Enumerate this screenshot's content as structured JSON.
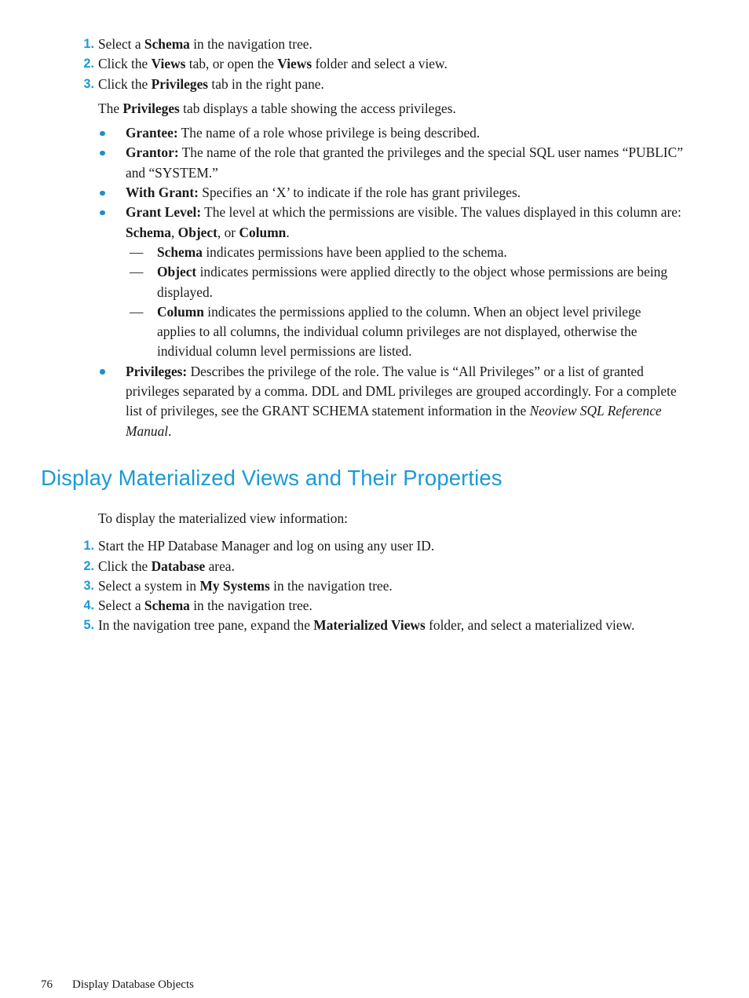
{
  "document": {
    "colors": {
      "heading": "#1b9ad6",
      "list_number": "#1b9ad6",
      "bullet": "#1b8fc9",
      "body_text": "#1a1a1a",
      "page_background": "#ffffff"
    }
  },
  "privileges_procedure": {
    "steps": [
      {
        "number": "1.",
        "html": "Select a <b>Schema</b> in the navigation tree."
      },
      {
        "number": "2.",
        "html": "Click the <b>Views</b> tab, or open the <b>Views</b> folder and select a view."
      },
      {
        "number": "3.",
        "html": "Click the <b>Privileges</b> tab in the right pane."
      }
    ],
    "intro_paragraph_html": "The <b>Privileges</b> tab displays a table showing the access privileges."
  },
  "privileges_columns": {
    "items": [
      {
        "term": "Grantee:",
        "html": "<b>Grantee:</b> The name of a role whose privilege is being described."
      },
      {
        "term": "Grantor:",
        "html": "<b>Grantor:</b> The name of the role that granted the privileges and the special SQL user names “PUBLIC” and “SYSTEM.”"
      },
      {
        "term": "With Grant:",
        "html": "<b>With Grant:</b> Specifies an ‘X’ to indicate if the role has grant privileges."
      },
      {
        "term": "Grant Level:",
        "html": "<b>Grant Level:</b> The level at which the permissions are visible. The values displayed in this column are: <b>Schema</b>, <b>Object</b>, or <b>Column</b>."
      },
      {
        "term": "Privileges:",
        "html": "<b>Privileges:</b> Describes the privilege of the role. The value is “All Privileges” or a list of granted privileges separated by a comma. DDL and DML privileges are grouped accordingly. For a complete list of privileges, see the GRANT SCHEMA statement information in the <i>Neoview SQL Reference Manual</i>."
      }
    ],
    "grant_level_sublist": [
      {
        "dash": "—",
        "html": "<b>Schema</b> indicates permissions have been applied to the schema."
      },
      {
        "dash": "—",
        "html": "<b>Object</b> indicates permissions were applied directly to the object whose permissions are being displayed."
      },
      {
        "dash": "—",
        "html": "<b>Column</b> indicates the permissions applied to the column. When an object level privilege applies to all columns, the individual column privileges are not displayed, otherwise the individual column level permissions are listed."
      }
    ]
  },
  "materialized_views_section": {
    "heading": "Display Materialized Views and Their Properties",
    "intro_paragraph_html": "To display the materialized view information:",
    "steps": [
      {
        "number": "1.",
        "html": "Start the HP Database Manager and log on using any user ID."
      },
      {
        "number": "2.",
        "html": "Click the <b>Database</b> area."
      },
      {
        "number": "3.",
        "html": "Select a system in <b>My Systems</b> in the navigation tree."
      },
      {
        "number": "4.",
        "html": "Select a <b>Schema</b> in the navigation tree."
      },
      {
        "number": "5.",
        "html": "In the navigation tree pane, expand the <b>Materialized Views</b> folder, and select a materialized view."
      }
    ]
  },
  "footer": {
    "page_number": "76",
    "chapter_label": "Display Database Objects"
  }
}
